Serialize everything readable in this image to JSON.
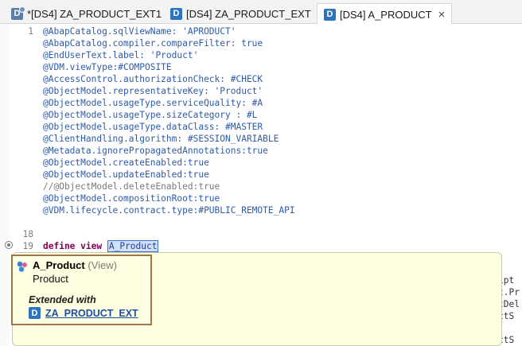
{
  "tabs": [
    {
      "label": "*[DS4] ZA_PRODUCT_EXT1",
      "icon": "ddl-extension-icon",
      "active": false
    },
    {
      "label": "[DS4] ZA_PRODUCT_EXT",
      "icon": "ddl-icon",
      "active": false
    },
    {
      "label": "[DS4] A_PRODUCT",
      "icon": "ddl-icon",
      "active": true,
      "close": "×"
    }
  ],
  "editor": {
    "lines": [
      {
        "n": "1",
        "text": "@AbapCatalog.sqlViewName: 'APRODUCT'"
      },
      {
        "n": "",
        "text": "@AbapCatalog.compiler.compareFilter: true"
      },
      {
        "n": "",
        "text": "@EndUserText.label: 'Product'"
      },
      {
        "n": "",
        "text": "@VDM.viewType:#COMPOSITE"
      },
      {
        "n": "",
        "text": "@AccessControl.authorizationCheck: #CHECK"
      },
      {
        "n": "",
        "text": "@ObjectModel.representativeKey: 'Product'"
      },
      {
        "n": "",
        "text": "@ObjectModel.usageType.serviceQuality: #A"
      },
      {
        "n": "",
        "text": "@ObjectModel.usageType.sizeCategory : #L"
      },
      {
        "n": "",
        "text": "@ObjectModel.usageType.dataClass: #MASTER"
      },
      {
        "n": "",
        "text": "@ClientHandling.algorithm: #SESSION_VARIABLE"
      },
      {
        "n": "",
        "text": "@Metadata.ignorePropagatedAnnotations:true"
      },
      {
        "n": "",
        "text": "@ObjectModel.createEnabled:true"
      },
      {
        "n": "",
        "text": "@ObjectModel.updateEnabled:true"
      },
      {
        "n": "",
        "text": "//@ObjectModel.deleteEnabled:true"
      },
      {
        "n": "",
        "text": "@ObjectModel.compositionRoot:true"
      },
      {
        "n": "",
        "text": "@VDM.lifecycle.contract.type:#PUBLIC_REMOTE_API"
      },
      {
        "n": "",
        "text": ""
      },
      {
        "n": "18",
        "text": ""
      },
      {
        "n": "19",
        "keyword": "define view",
        "selected": "A_Product"
      }
    ],
    "right_fragments": [
      "ipt",
      "t.Pr",
      "tDel",
      "ctS",
      "ctS"
    ]
  },
  "popup": {
    "title": "A_Product",
    "type": "(View)",
    "subtitle": "Product",
    "extended_label": "Extended with",
    "extension_link": "ZA_PRODUCT_EXT"
  }
}
